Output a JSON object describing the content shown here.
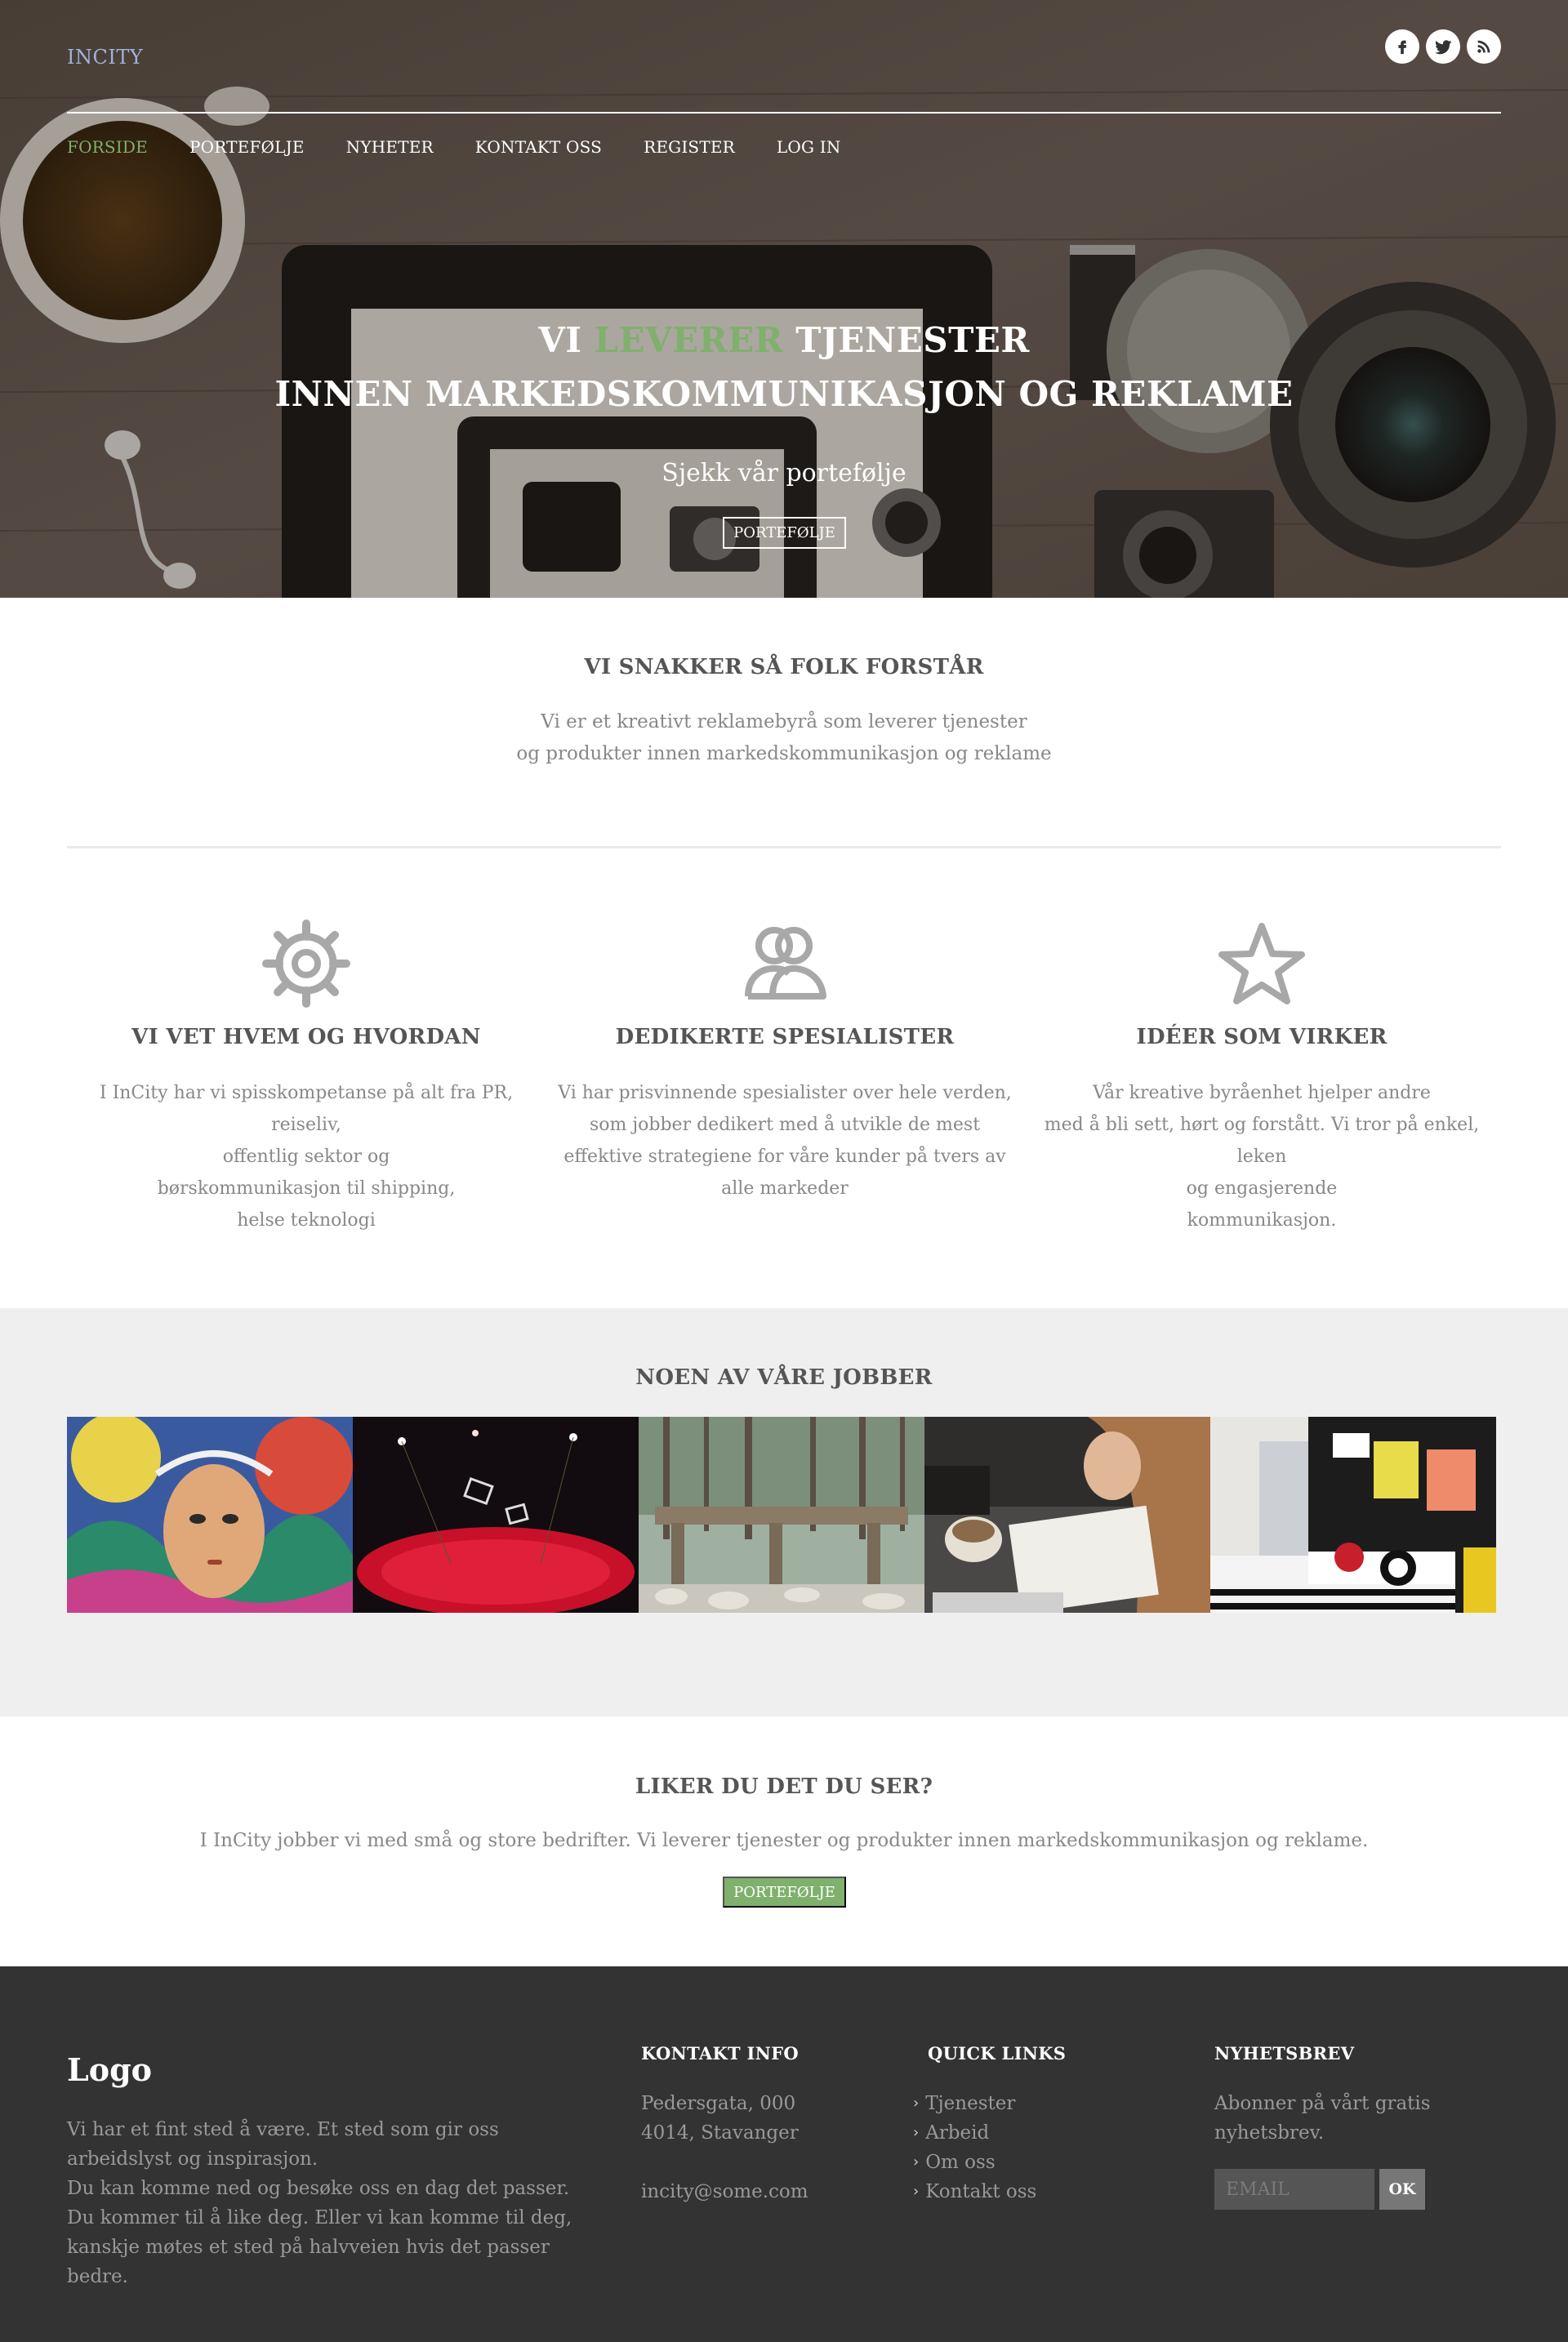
{
  "header": {
    "brand": "INCITY",
    "nav": [
      "FORSIDE",
      "PORTEFØLJE",
      "NYHETER",
      "KONTAKT OSS",
      "REGISTER",
      "LOG IN"
    ],
    "active_nav": "FORSIDE",
    "social_icons": [
      "facebook-icon",
      "twitter-icon",
      "rss-icon"
    ]
  },
  "hero": {
    "line1_pre": "VI",
    "line1_accent": "LEVERER",
    "line1_post": "TJENESTER",
    "line2": "INNEN MARKEDSKOMMUNIKASJON OG REKLAME",
    "subtitle": "Sjekk vår portefølje",
    "button": "PORTEFØLJE"
  },
  "intro": {
    "title": "VI SNAKKER SÅ FOLK FORSTÅR",
    "lines": [
      "Vi er et kreativt reklamebyrå som leverer tjenester",
      "og produkter innen markedskommunikasjon og reklame"
    ]
  },
  "features": [
    {
      "icon": "gear-icon",
      "title": "VI VET HVEM OG HVORDAN",
      "lines": [
        "I InCity har vi spisskompetanse på alt fra PR, reiseliv,",
        "offentlig sektor og",
        "børskommunikasjon til shipping,",
        "helse teknologi"
      ]
    },
    {
      "icon": "users-icon",
      "title": "DEDIKERTE SPESIALISTER",
      "lines": [
        "Vi har prisvinnende spesialister over hele verden,",
        "som jobber dedikert med å utvikle de mest",
        "effektive strategiene for våre kunder på tvers av",
        "alle markeder"
      ]
    },
    {
      "icon": "star-icon",
      "title": "IDÉER SOM VIRKER",
      "lines": [
        "Vår kreative byråenhet hjelper andre",
        "med å bli sett, hørt og forstått. Vi tror på enkel, leken",
        "og engasjerende",
        "kommunikasjon."
      ]
    }
  ],
  "jobs": {
    "title": "NOEN AV VÅRE JOBBER"
  },
  "cta": {
    "title": "LIKER DU DET DU SER?",
    "text": "I InCity jobber vi med små og store bedrifter. Vi leverer tjenester og produkter innen markedskommunikasjon og reklame.",
    "button": "PORTEFØLJE"
  },
  "footer": {
    "logo": "Logo",
    "about": [
      "Vi har et fint sted å være. Et sted som gir oss arbeidslyst og inspirasjon.",
      "Du kan komme ned og besøke oss en dag det passer.",
      "Du kommer til å like deg. Eller vi kan komme til deg, kanskje møtes et sted på halvveien hvis det passer bedre."
    ],
    "contact_title": "KONTAKT INFO",
    "address1": "Pedersgata, 000",
    "address2": "4014, Stavanger",
    "email": "incity@some.com",
    "links_title": "QUICK LINKS",
    "links": [
      "Tjenester",
      "Arbeid",
      "Om oss",
      "Kontakt oss"
    ],
    "newsletter_title": "NYHETSBREV",
    "newsletter_text": "Abonner på vårt gratis nyhetsbrev.",
    "email_placeholder": "EMAIL",
    "ok_button": "OK"
  },
  "colors": {
    "accent": "#7fb06c",
    "brand": "#9fb3d9",
    "footer_bg": "#333333",
    "jobs_bg": "#efefef"
  }
}
